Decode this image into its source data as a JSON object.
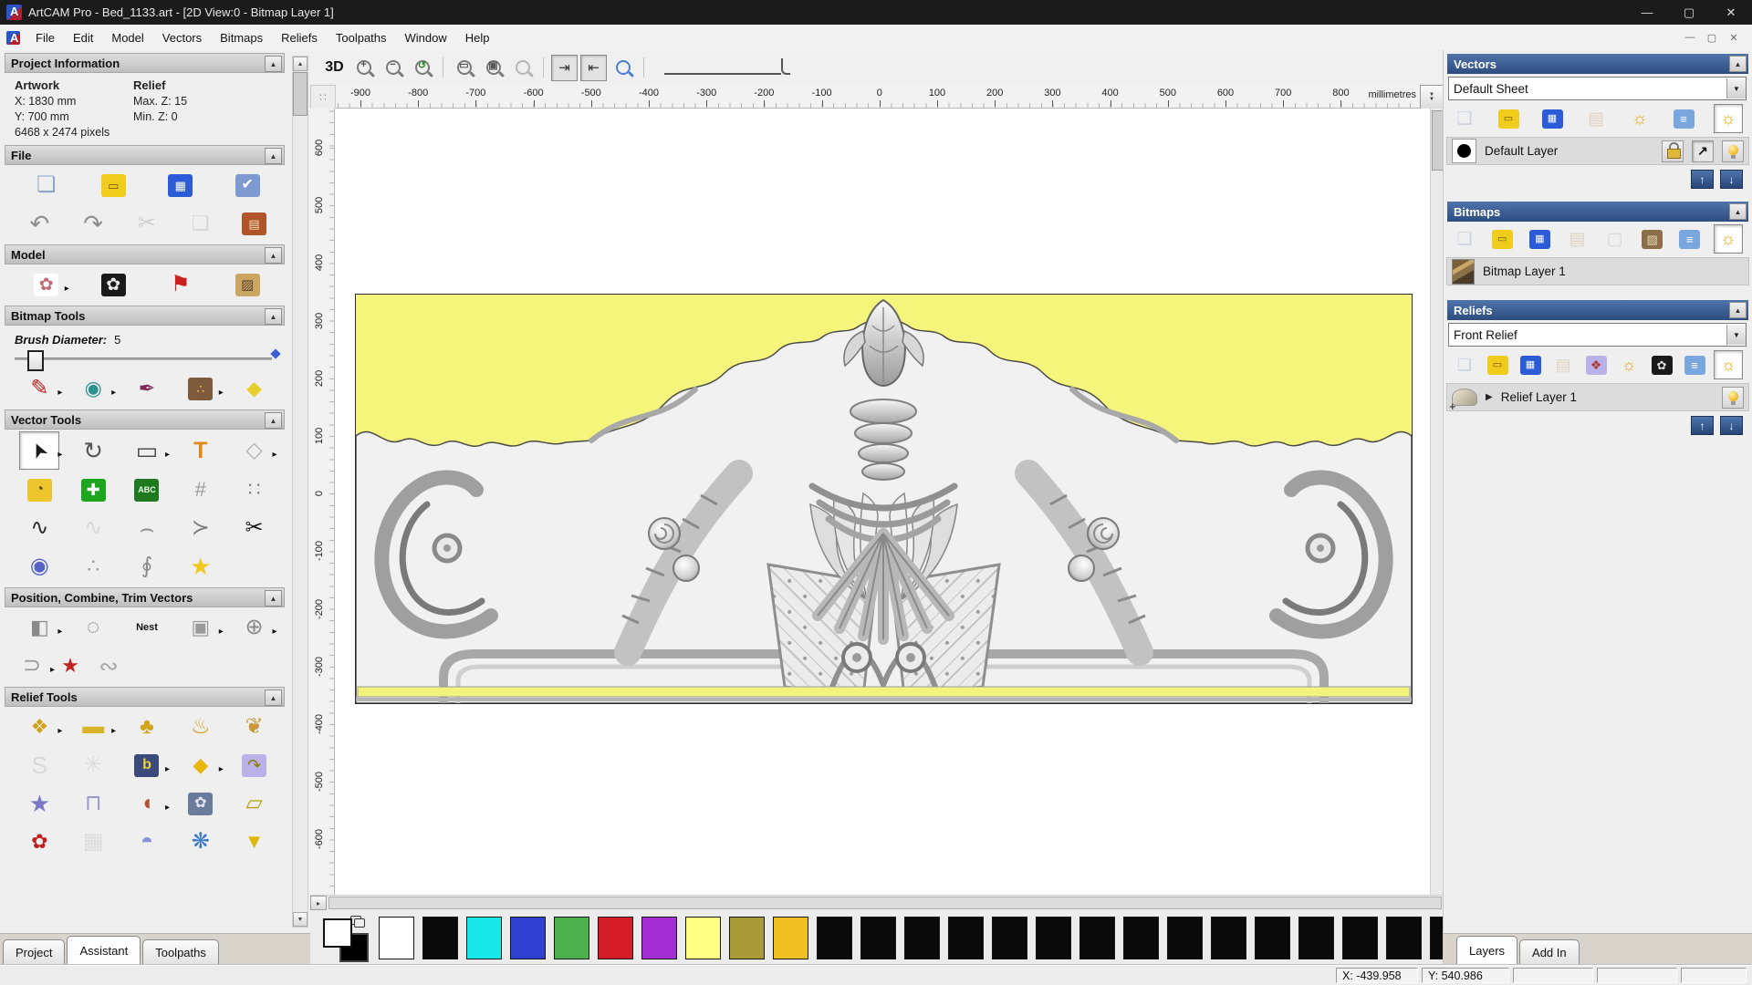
{
  "window": {
    "title": "ArtCAM Pro - Bed_1133.art - [2D View:0 - Bitmap Layer 1]",
    "controls": {
      "minimize": "—",
      "maximize": "▢",
      "close": "✕"
    }
  },
  "menu": {
    "items": [
      "File",
      "Edit",
      "Model",
      "Vectors",
      "Bitmaps",
      "Reliefs",
      "Toolpaths",
      "Window",
      "Help"
    ]
  },
  "left_panel": {
    "project_information": {
      "title": "Project Information",
      "artwork_label": "Artwork",
      "artwork_x": "X: 1830 mm",
      "artwork_y": "Y: 700 mm",
      "artwork_pixels": "6468 x 2474 pixels",
      "relief_label": "Relief",
      "relief_max": "Max. Z: 15",
      "relief_min": "Min. Z: 0"
    },
    "file": {
      "title": "File",
      "icons_row1": [
        {
          "n": "new-model-icon",
          "g": "❏",
          "c": "#8fa6c8",
          "fs": 24
        },
        {
          "n": "open-model-icon",
          "g": "▭",
          "c": "#6b5500",
          "bg": "#f0cd1d",
          "fs": 13
        },
        {
          "n": "save-model-icon",
          "g": "▦",
          "c": "#ffffff",
          "bg": "#2b5bd7",
          "fs": 13
        },
        {
          "n": "model-properties-icon",
          "g": "✔",
          "c": "#ffffff",
          "bg": "#7d9ad1",
          "fs": 16
        }
      ],
      "icons_row2": [
        {
          "n": "undo-icon",
          "g": "↶",
          "c": "#8d8d8d",
          "fs": 26
        },
        {
          "n": "redo-icon",
          "g": "↷",
          "c": "#8d8d8d",
          "fs": 26
        },
        {
          "n": "cut-icon",
          "g": "✂",
          "c": "#a8a8a8",
          "fs": 24,
          "dis": true
        },
        {
          "n": "copy-icon",
          "g": "❏",
          "c": "#b8b8b8",
          "fs": 22,
          "dis": true
        },
        {
          "n": "paste-icon",
          "g": "▤",
          "c": "#f3e0b4",
          "bg": "#b0552a",
          "fs": 13
        }
      ]
    },
    "model": {
      "title": "Model",
      "icons": [
        {
          "n": "relief-from-image-icon",
          "g": "✿",
          "c": "#c06878",
          "bg": "#ffffff",
          "fs": 19,
          "ar": true
        },
        {
          "n": "greyscale-from-relief-icon",
          "g": "✿",
          "c": "#e8e8e8",
          "bg": "#1a1a1a",
          "fs": 19
        },
        {
          "n": "render-lighting-icon",
          "g": "⚑",
          "c": "#cc1f1f",
          "fs": 24
        },
        {
          "n": "clear-bitmap-icon",
          "g": "▨",
          "c": "#5a4630",
          "bg": "#caa662",
          "fs": 15
        }
      ]
    },
    "bitmap_tools": {
      "title": "Bitmap Tools",
      "brush_label": "Brush Diameter:",
      "brush_value": "5",
      "icons": [
        {
          "n": "paint-brush-icon",
          "g": "✎",
          "c": "#c42020",
          "fs": 24,
          "ar": true
        },
        {
          "n": "flood-fill-icon",
          "g": "◉",
          "c": "#2e8f8f",
          "fs": 22,
          "ar": true
        },
        {
          "n": "pick-colour-icon",
          "g": "✒",
          "c": "#7c2a52",
          "fs": 22
        },
        {
          "n": "colour-palette-icon",
          "g": "∴",
          "c": "#ffd24a",
          "bg": "#7d5b3c",
          "fs": 14,
          "ar": true
        },
        {
          "n": "flood-fill-vectors-icon",
          "g": "◆",
          "c": "#e8cf2e",
          "fs": 22
        }
      ]
    },
    "vector_tools": {
      "title": "Vector Tools",
      "icons_row1": [
        {
          "n": "select-vectors-icon",
          "g": "➤",
          "c": "#1a1a1a",
          "fs": 22,
          "pr": true,
          "ar": true,
          "cls": "rotsel"
        },
        {
          "n": "transform-vectors-icon",
          "g": "↻",
          "c": "#555555",
          "fs": 26
        },
        {
          "n": "create-rectangle-icon",
          "g": "▭",
          "c": "#444444",
          "fs": 26,
          "ar": true
        },
        {
          "n": "create-text-icon",
          "g": "T",
          "c": "#e08818",
          "fs": 25,
          "b": true
        },
        {
          "n": "envelope-distort-icon",
          "g": "◇",
          "c": "#b0b0b0",
          "fs": 24,
          "ar": true
        }
      ],
      "icons_row2": [
        {
          "n": "measure-icon",
          "g": "◔",
          "c": "#55430a",
          "bg": "#ecc62c",
          "fs": 16
        },
        {
          "n": "green-cross-icon",
          "g": "✚",
          "c": "#ffffff",
          "bg": "#1ea51e",
          "fs": 18
        },
        {
          "n": "vector-library-icon",
          "g": "ABC",
          "c": "#eaffea",
          "bg": "#1f7a1f",
          "fs": 9,
          "b": true
        },
        {
          "n": "wrap-vectors-icon",
          "g": "#",
          "c": "#9a9a9a",
          "fs": 22
        },
        {
          "n": "paste-array-icon",
          "g": "∷",
          "c": "#8a8a8a",
          "fs": 22
        }
      ],
      "icons_row3": [
        {
          "n": "create-polyline-icon",
          "g": "∿",
          "c": "#2a2a2a",
          "fs": 24
        },
        {
          "n": "free-sketch-icon",
          "g": "∿",
          "c": "#bdbdbd",
          "fs": 24,
          "dis": true
        },
        {
          "n": "bezier-curve-icon",
          "g": "⌢",
          "c": "#8a8a8a",
          "fs": 26
        },
        {
          "n": "arc-tool-icon",
          "g": "≻",
          "c": "#7a7a7a",
          "fs": 24
        },
        {
          "n": "trim-vectors-icon",
          "g": "✂",
          "c": "#161616",
          "fs": 24
        }
      ],
      "icons_row4": [
        {
          "n": "extrude-dome-icon",
          "g": "◉",
          "c": "#5863c8",
          "fs": 24
        },
        {
          "n": "node-editing-icon",
          "g": "∴",
          "c": "#9a9a9a",
          "fs": 22
        },
        {
          "n": "mirror-vectors-icon",
          "g": "∮",
          "c": "#8a8a8a",
          "fs": 24
        },
        {
          "n": "vector-doctor-icon",
          "g": "★",
          "c": "#f0c81e",
          "fs": 26
        }
      ]
    },
    "pct": {
      "title": "Position, Combine, Trim Vectors",
      "icons_row1": [
        {
          "n": "align-vectors-icon",
          "g": "◧",
          "c": "#8a8a8a",
          "fs": 22,
          "ar": true
        },
        {
          "n": "text-on-curve-icon",
          "g": "◌",
          "c": "#7a7a7a",
          "fs": 24
        },
        {
          "n": "nesting-icon",
          "g": "Nest",
          "c": "#111111",
          "fs": 11,
          "b": true
        },
        {
          "n": "group-vectors-icon",
          "g": "▣",
          "c": "#9a9a9a",
          "fs": 22,
          "ar": true
        },
        {
          "n": "weld-vectors-icon",
          "g": "⊕",
          "c": "#8a8a8a",
          "fs": 24,
          "ar": true
        }
      ],
      "icons_row2": [
        {
          "n": "join-vectors-icon",
          "g": "⊃",
          "c": "#9a9a9a",
          "fs": 24,
          "ar": true
        },
        {
          "n": "vector-texture-icon",
          "g": "★",
          "c": "#c22222",
          "fs": 22
        },
        {
          "n": "interlock-spiral-icon",
          "g": "∾",
          "c": "#a8a8a8",
          "fs": 26
        }
      ]
    },
    "relief_tools": {
      "title": "Relief Tools",
      "icons_row1": [
        {
          "n": "sculpt-relief-icon",
          "g": "❖",
          "c": "#d0a017",
          "fs": 22,
          "ar": true
        },
        {
          "n": "zero-plane-icon",
          "g": "▬",
          "c": "#d9b32a",
          "fs": 24,
          "ar": true
        },
        {
          "n": "add-relief-icon",
          "g": "♣",
          "c": "#d2a51e",
          "fs": 24
        },
        {
          "n": "dome-relief-icon",
          "g": "♨",
          "c": "#cfa018",
          "fs": 24
        },
        {
          "n": "merge-relief-icon",
          "g": "❦",
          "c": "#c89a3a",
          "fs": 24
        }
      ],
      "icons_row2": [
        {
          "n": "smooth-relief-icon",
          "g": "S",
          "c": "#bdbdbd",
          "fs": 26,
          "dis": true
        },
        {
          "n": "texture-weave-icon",
          "g": "✳",
          "c": "#c4c4c4",
          "fs": 24,
          "dis": true
        },
        {
          "n": "relief-library-icon",
          "g": "b",
          "c": "#f3d22a",
          "bg": "#3a4a7a",
          "fs": 16,
          "b": true,
          "ar": true
        },
        {
          "n": "offset-relief-icon",
          "g": "◆",
          "c": "#e8b70a",
          "fs": 22,
          "ar": true
        },
        {
          "n": "wrap-relief-icon",
          "g": "↷",
          "c": "#8a7a00",
          "bg": "#b8b2e8",
          "fs": 18
        }
      ],
      "icons_row3": [
        {
          "n": "star-relief-icon",
          "g": "★",
          "c": "#7a7ac8",
          "fs": 26
        },
        {
          "n": "constrain-relief-icon",
          "g": "⊓",
          "c": "#9a9ace",
          "fs": 24
        },
        {
          "n": "carve-relief-icon",
          "g": "◖",
          "c": "#b05238",
          "fs": 24,
          "ar": true
        },
        {
          "n": "emboss-relief-icon",
          "g": "✿",
          "c": "#dfe6f2",
          "bg": "#6a7c9c",
          "fs": 16
        },
        {
          "n": "stack-relief-icon",
          "g": "▱",
          "c": "#b8a20a",
          "fs": 24
        }
      ],
      "icons_row4": [
        {
          "n": "red-relief-icon",
          "g": "✿",
          "c": "#c02020",
          "fs": 22
        },
        {
          "n": "basket-weave-icon",
          "g": "▦",
          "c": "#c6c6c6",
          "fs": 24,
          "dis": true
        },
        {
          "n": "blue-dome-icon",
          "g": "◓",
          "c": "#8a90d8",
          "fs": 24
        },
        {
          "n": "sphere-texture-icon",
          "g": "❋",
          "c": "#3a78c8",
          "fs": 24
        },
        {
          "n": "fan-relief-icon",
          "g": "▼",
          "c": "#e0b80a",
          "fs": 22
        }
      ]
    },
    "tabs": [
      {
        "label": "Project",
        "active": false
      },
      {
        "label": "Assistant",
        "active": true
      },
      {
        "label": "Toolpaths",
        "active": false
      }
    ]
  },
  "toolbar": {
    "view3d": "3D"
  },
  "rulers": {
    "unit": "millimetres",
    "h": [
      "-900",
      "-800",
      "-700",
      "-600",
      "-500",
      "-400",
      "-300",
      "-200",
      "-100",
      "0",
      "100",
      "200",
      "300",
      "400",
      "500",
      "600",
      "700",
      "800"
    ],
    "v": [
      "600",
      "500",
      "400",
      "300",
      "200",
      "100",
      "0",
      "-100",
      "-200",
      "-300",
      "-400",
      "-500",
      "-600"
    ]
  },
  "right_panel": {
    "vectors": {
      "title": "Vectors",
      "sheet_value": "Default Sheet",
      "icons": [
        {
          "n": "new-vector-layer-icon",
          "g": "❏",
          "c": "#9eb0cc",
          "fs": 19,
          "dis": true
        },
        {
          "n": "open-vector-layer-icon",
          "g": "▭",
          "c": "#6b5500",
          "bg": "#f0cd1d",
          "fs": 11
        },
        {
          "n": "save-vector-layer-icon",
          "g": "▦",
          "c": "#ffffff",
          "bg": "#2b5bd7",
          "fs": 11
        },
        {
          "n": "merge-vector-layers-icon",
          "g": "▤",
          "c": "#cbb07e",
          "fs": 19,
          "dis": true
        },
        {
          "n": "layer-visibility-icon",
          "g": "☼",
          "c": "#e8a70a",
          "fs": 19
        },
        {
          "n": "delete-layer-icon",
          "g": "≡",
          "c": "#ffffff",
          "bg": "#7aa6de",
          "fs": 13
        },
        {
          "n": "all-layers-visibility-icon",
          "g": "☼",
          "c": "#e8a70a",
          "fs": 19,
          "pr": true
        }
      ],
      "layer": {
        "name": "Default Layer"
      }
    },
    "bitmaps": {
      "title": "Bitmaps",
      "icons": [
        {
          "n": "new-bitmap-layer-icon",
          "g": "❏",
          "c": "#9eb0cc",
          "fs": 19,
          "dis": true
        },
        {
          "n": "open-bitmap-layer-icon",
          "g": "▭",
          "c": "#6b5500",
          "bg": "#f0cd1d",
          "fs": 11
        },
        {
          "n": "save-bitmap-layer-icon",
          "g": "▦",
          "c": "#ffffff",
          "bg": "#2b5bd7",
          "fs": 11
        },
        {
          "n": "merge-bitmap-layers-icon",
          "g": "▤",
          "c": "#cbb07e",
          "fs": 19,
          "dis": true
        },
        {
          "n": "blank-bitmap-icon",
          "g": "▢",
          "c": "#b8b8b8",
          "fs": 19,
          "dis": true
        },
        {
          "n": "bitmap-preview-icon",
          "g": "▨",
          "c": "#e8d8b0",
          "bg": "#8a6f4a",
          "fs": 13
        },
        {
          "n": "delete-bitmap-layer-icon",
          "g": "≡",
          "c": "#ffffff",
          "bg": "#7aa6de",
          "fs": 13
        },
        {
          "n": "all-bitmaps-visibility-icon",
          "g": "☼",
          "c": "#e8a70a",
          "fs": 19,
          "pr": true
        }
      ],
      "layer": {
        "name": "Bitmap Layer 1"
      }
    },
    "reliefs": {
      "title": "Reliefs",
      "relief_value": "Front Relief",
      "icons": [
        {
          "n": "new-relief-layer-icon",
          "g": "❏",
          "c": "#9eb0cc",
          "fs": 18,
          "dis": true
        },
        {
          "n": "open-relief-layer-icon",
          "g": "▭",
          "c": "#6b5500",
          "bg": "#f0cd1d",
          "fs": 11
        },
        {
          "n": "save-relief-layer-icon",
          "g": "▦",
          "c": "#ffffff",
          "bg": "#2b5bd7",
          "fs": 11
        },
        {
          "n": "merge-relief-layers-icon",
          "g": "▤",
          "c": "#cbb07e",
          "fs": 18,
          "dis": true
        },
        {
          "n": "relief-stack-icon",
          "g": "❖",
          "c": "#b03a3a",
          "bg": "#b8b2e8",
          "fs": 14
        },
        {
          "n": "relief-visibility-icon",
          "g": "☼",
          "c": "#e8a70a",
          "fs": 18
        },
        {
          "n": "greyscale-preview-icon",
          "g": "✿",
          "c": "#dddddd",
          "bg": "#1a1a1a",
          "fs": 13
        },
        {
          "n": "delete-relief-layer-icon",
          "g": "≡",
          "c": "#ffffff",
          "bg": "#7aa6de",
          "fs": 13
        },
        {
          "n": "all-reliefs-visibility-icon",
          "g": "☼",
          "c": "#e8a70a",
          "fs": 18,
          "pr": true
        }
      ],
      "layer": {
        "name": "Relief Layer 1"
      }
    },
    "tabs": [
      {
        "label": "Layers",
        "active": true
      },
      {
        "label": "Add In",
        "active": false
      }
    ]
  },
  "palette": {
    "colors": [
      "#ffffff",
      "#0a0a0a",
      "#18e8e8",
      "#2f3fcf",
      "#4cb04c",
      "#d41c28",
      "#a32fd4",
      "#ffff84",
      "#a89a38",
      "#f0c020",
      "#0a0a0a",
      "#0a0a0a",
      "#0a0a0a",
      "#0a0a0a",
      "#0a0a0a",
      "#0a0a0a",
      "#0a0a0a",
      "#0a0a0a",
      "#0a0a0a",
      "#0a0a0a",
      "#0a0a0a",
      "#0a0a0a",
      "#0a0a0a",
      "#0a0a0a",
      "#0a0a0a"
    ]
  },
  "status": {
    "cells": [
      "X: -439.958",
      "Y: 540.986",
      "",
      "",
      ""
    ]
  }
}
